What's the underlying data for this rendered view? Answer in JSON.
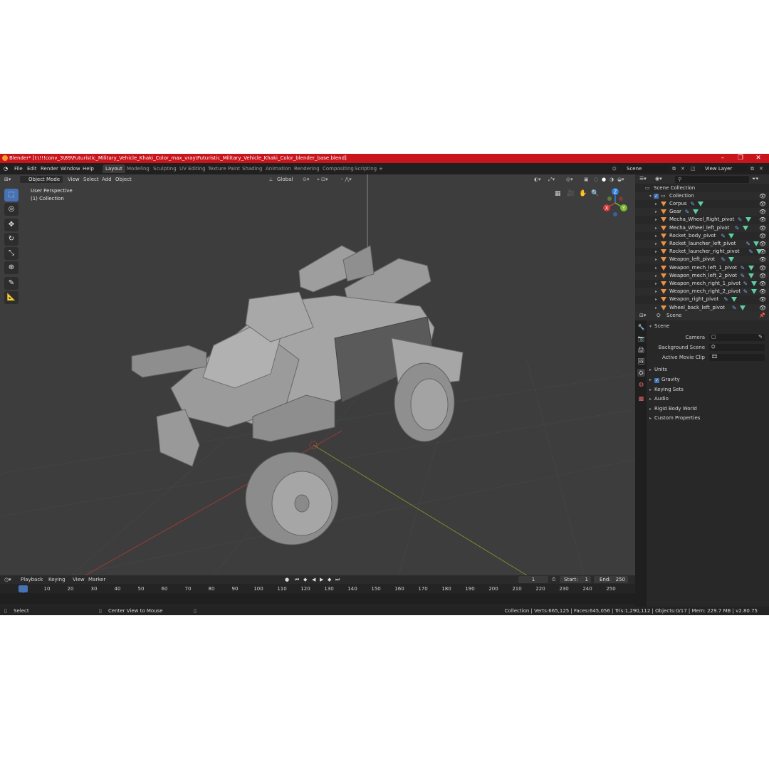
{
  "window": {
    "title": "Blender* [I:\\!!!conv_3\\89\\Futuristic_Military_Vehicle_Khaki_Color_max_vray\\Futuristic_Military_Vehicle_Khaki_Color_blender_base.blend]"
  },
  "menu": [
    "File",
    "Edit",
    "Render",
    "Window",
    "Help"
  ],
  "workspaces": [
    "Layout",
    "Modeling",
    "Sculpting",
    "UV Editing",
    "Texture Paint",
    "Shading",
    "Animation",
    "Rendering",
    "Compositing",
    "Scripting"
  ],
  "active_workspace": "Layout",
  "top_right": {
    "scene": "Scene",
    "view_layer": "View Layer"
  },
  "viewport": {
    "mode": "Object Mode",
    "menus": [
      "View",
      "Select",
      "Add",
      "Object"
    ],
    "transform_orientation": "Global",
    "info_line1": "User Perspective",
    "info_line2": "(1) Collection",
    "gizmo": {
      "z": "Z",
      "y": "Y",
      "x": "X"
    }
  },
  "timeline": {
    "menus": [
      "Playback",
      "Keying",
      "View",
      "Marker"
    ],
    "current_frame": "1",
    "start_label": "Start:",
    "start": "1",
    "end_label": "End:",
    "end": "250",
    "ticks": [
      "1",
      "10",
      "20",
      "30",
      "40",
      "50",
      "60",
      "70",
      "80",
      "90",
      "100",
      "110",
      "120",
      "130",
      "140",
      "150",
      "160",
      "170",
      "180",
      "190",
      "200",
      "210",
      "220",
      "230",
      "240",
      "250"
    ]
  },
  "statusbar": {
    "left": "Select",
    "middle": "Center View to Mouse",
    "right": "Collection | Verts:665,125 | Faces:645,056 | Tris:1,290,112 | Objects:0/17 | Mem: 229.7 MB | v2.80.75"
  },
  "outliner": {
    "root": "Scene Collection",
    "collection": "Collection",
    "items": [
      "Corpus",
      "Gear",
      "Mecha_Wheel_Right_pivot",
      "Mecha_Wheel_left_pivot",
      "Rocket_body_pivot",
      "Rocket_launcher_left_pivot",
      "Rocket_launcher_right_pivot",
      "Weapon_left_pivot",
      "Weapon_mech_left_1_pivot",
      "Weapon_mech_left_2_pivot",
      "Weapon_mech_right_1_pivot",
      "Weapon_mech_right_2_pivot",
      "Weapon_right_pivot",
      "Wheel_back_left_pivot"
    ]
  },
  "properties": {
    "context": "Scene",
    "panel": "Scene",
    "camera_label": "Camera",
    "background_label": "Background Scene",
    "movieclip_label": "Active Movie Clip",
    "sections": [
      "Units",
      "Gravity",
      "Keying Sets",
      "Audio",
      "Rigid Body World",
      "Custom Properties"
    ]
  },
  "colors": {
    "titlebar": "#c8141b",
    "accent": "#4772b3",
    "object_icon": "#e89346",
    "mesh_icon": "#5ecfa3"
  }
}
